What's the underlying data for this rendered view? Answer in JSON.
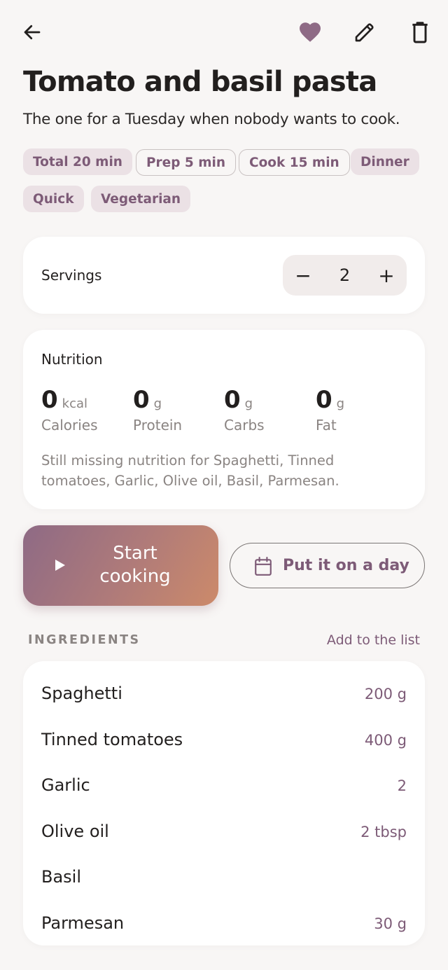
{
  "header": {
    "back_icon": "arrow-left-icon",
    "favorite_icon": "heart-icon",
    "edit_icon": "pencil-icon",
    "delete_icon": "trash-icon",
    "accent_color": "#8e6a85"
  },
  "recipe": {
    "title": "Tomato and basil pasta",
    "description": "The one for a Tuesday when nobody wants to cook.",
    "chips": [
      "Total 20 min",
      "Prep 5 min",
      "Cook 15 min",
      "Dinner",
      "Quick",
      "Vegetarian"
    ]
  },
  "servings": {
    "label": "Servings",
    "value": "2",
    "minus": "−",
    "plus": "+"
  },
  "nutrition": {
    "title": "Nutrition",
    "items": [
      {
        "value": "0",
        "unit": "kcal",
        "label": "Calories"
      },
      {
        "value": "0",
        "unit": "g",
        "label": "Protein"
      },
      {
        "value": "0",
        "unit": "g",
        "label": "Carbs"
      },
      {
        "value": "0",
        "unit": "g",
        "label": "Fat"
      }
    ],
    "missing": "Still missing nutrition for Spaghetti, Tinned tomatoes, Garlic, Olive oil, Basil, Parmesan."
  },
  "actions": {
    "start_label": "Start cooking",
    "day_label": "Put it on a day",
    "day_icon": "calendar-icon"
  },
  "ingredients": {
    "title": "INGREDIENTS",
    "action": "Add to the list",
    "items": [
      {
        "name": "Spaghetti",
        "qty": "200 g"
      },
      {
        "name": "Tinned tomatoes",
        "qty": "400 g"
      },
      {
        "name": "Garlic",
        "qty": "2"
      },
      {
        "name": "Olive oil",
        "qty": "2 tbsp"
      },
      {
        "name": "Basil",
        "qty": ""
      },
      {
        "name": "Parmesan",
        "qty": "30 g"
      }
    ]
  }
}
